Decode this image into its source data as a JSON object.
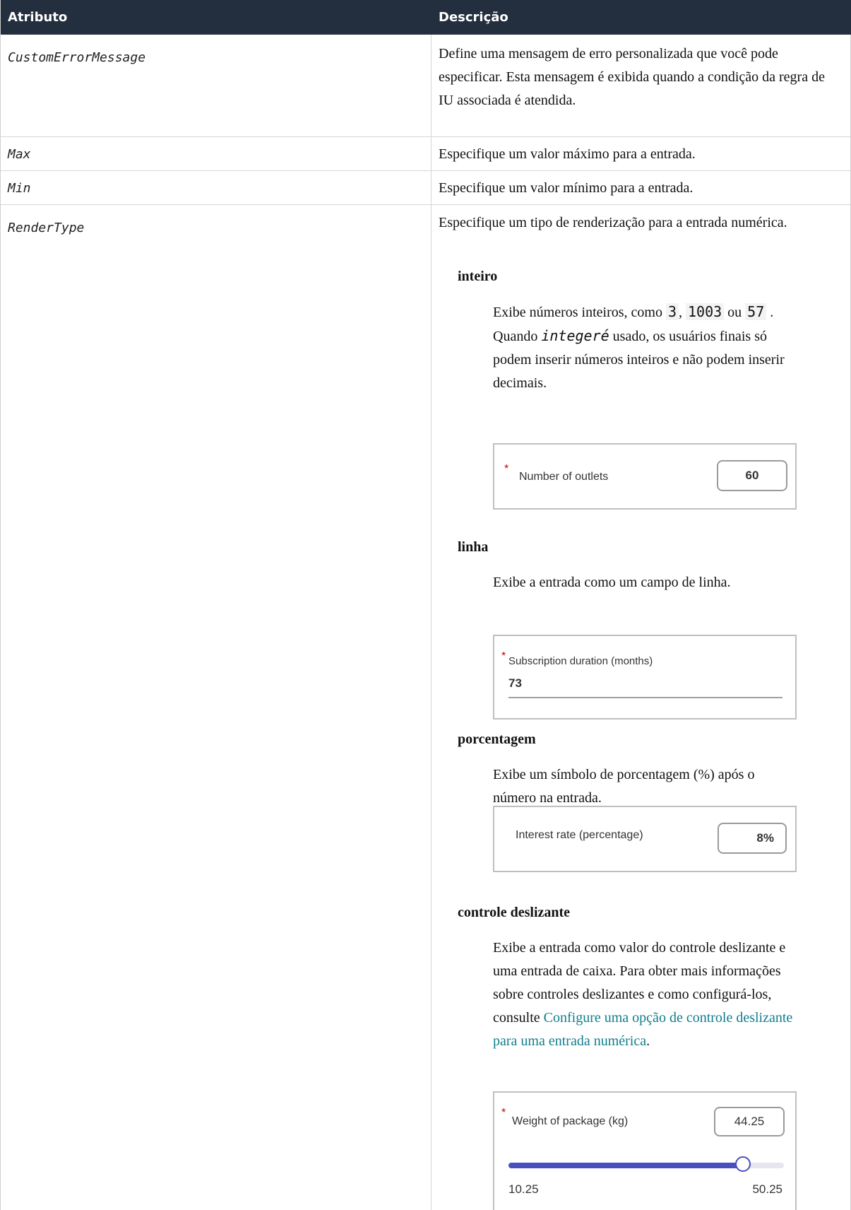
{
  "header": {
    "col1": "Atributo",
    "col2": "Descrição"
  },
  "rows": [
    {
      "attr": "CustomErrorMessage",
      "desc": "Define uma mensagem de erro personalizada que você pode especificar. Esta mensagem é exibida quando a condição da regra de IU associada é atendida."
    },
    {
      "attr": "Max",
      "desc": "Especifique um valor máximo para a entrada."
    },
    {
      "attr": "Min",
      "desc": "Especifique um valor mínimo para a entrada."
    },
    {
      "attr": "RenderType",
      "desc": "Especifique um tipo de renderização para a entrada numérica."
    }
  ],
  "render_types": {
    "inteiro": {
      "title": "inteiro",
      "text_a": "Exibe números inteiros, como",
      "code1": "3",
      "code2": "1003",
      "or": "ou",
      "code3": "57",
      "text_b": ". Quando",
      "code4": "integeré",
      "text_c": "usado, os usuários finais só podem inserir números inteiros e não podem inserir decimais.",
      "shot": {
        "label": "Number of outlets",
        "value": "60"
      }
    },
    "linha": {
      "title": "linha",
      "text": "Exibe a entrada como um campo de linha.",
      "shot": {
        "label": "Subscription duration (months)",
        "value": "73"
      }
    },
    "porcentagem": {
      "title": "porcentagem",
      "text": "Exibe um símbolo de porcentagem (%) após o número na entrada.",
      "shot": {
        "label": "Interest rate (percentage)",
        "value": "8%"
      }
    },
    "controle": {
      "title": "controle deslizante",
      "text": "Exibe a entrada como valor do controle deslizante e uma entrada de caixa. Para obter mais informações sobre controles deslizantes e como configurá-los, consulte",
      "link": "Configure uma opção de controle deslizante para uma entrada numérica",
      "period": ".",
      "shot": {
        "label": "Weight of package (kg)",
        "value": "44.25",
        "min": "10.25",
        "max": "50.25",
        "fill_fraction": 0.85
      }
    }
  },
  "colors": {
    "header_bg": "#232f3e",
    "link": "#0f7e8c",
    "slider": "#4a4fbf",
    "required": "#d10000"
  }
}
